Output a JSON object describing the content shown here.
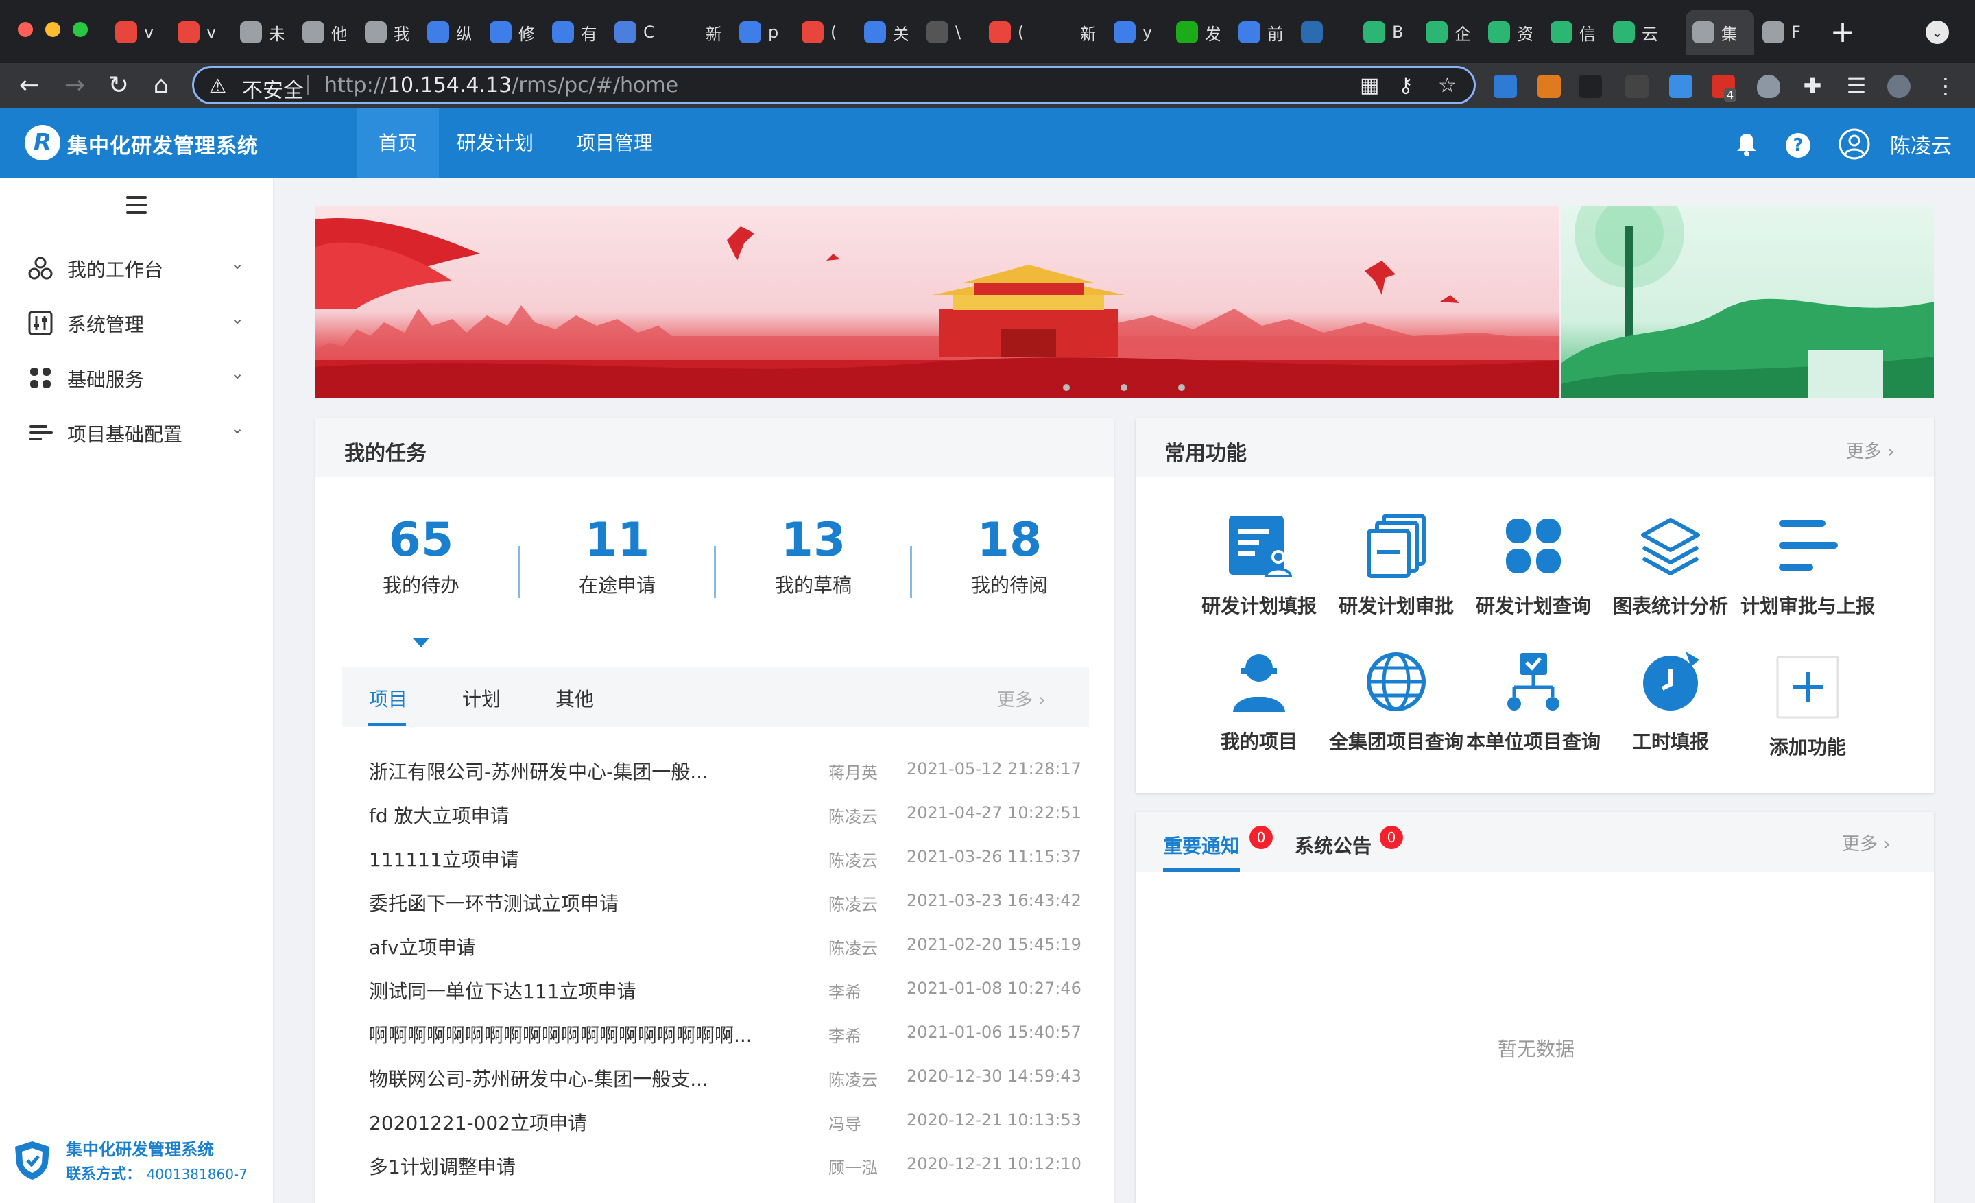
{
  "browser": {
    "tabs": [
      {
        "title": "v",
        "color": "#e8453c"
      },
      {
        "title": "v",
        "color": "#e8453c"
      },
      {
        "title": "未",
        "color": "#9aa0a6"
      },
      {
        "title": "他",
        "color": "#9aa0a6"
      },
      {
        "title": "我",
        "color": "#9aa0a6"
      },
      {
        "title": "纵",
        "color": "#3f7de8"
      },
      {
        "title": "修",
        "color": "#3f7de8"
      },
      {
        "title": "有",
        "color": "#3f7de8"
      },
      {
        "title": "C",
        "color": "#4a7fe0"
      },
      {
        "title": "新标签",
        "color": "#202124"
      },
      {
        "title": "p",
        "color": "#3f7de8"
      },
      {
        "title": "(",
        "color": "#e8453c"
      },
      {
        "title": "关",
        "color": "#3f7de8"
      },
      {
        "title": "\\",
        "color": "#555"
      },
      {
        "title": "(",
        "color": "#e8453c"
      },
      {
        "title": "新标签",
        "color": "#202124"
      },
      {
        "title": "y",
        "color": "#3f7de8"
      },
      {
        "title": "发",
        "color": "#1aad19"
      },
      {
        "title": "前",
        "color": "#3f7de8"
      },
      {
        "title": "",
        "color": "#2b6cb0"
      },
      {
        "title": "B",
        "color": "#2bb673"
      },
      {
        "title": "企",
        "color": "#2bb673"
      },
      {
        "title": "资",
        "color": "#2bb673"
      },
      {
        "title": "信",
        "color": "#2bb673"
      },
      {
        "title": "云",
        "color": "#2bb673"
      },
      {
        "title": "集",
        "color": "#9aa0a6"
      },
      {
        "title": "F",
        "color": "#9aa0a6"
      }
    ],
    "insecure_label": "不安全",
    "url_scheme": "http://",
    "url_host": "10.154.4.13",
    "url_path": "/rms/pc/#/home",
    "extension_badge": "4"
  },
  "header": {
    "app_title": "集中化研发管理系统",
    "logo_letter": "R",
    "nav": [
      "首页",
      "研发计划",
      "项目管理"
    ],
    "user_name": "陈凌云",
    "help_glyph": "?"
  },
  "sidebar": {
    "items": [
      {
        "label": "我的工作台"
      },
      {
        "label": "系统管理"
      },
      {
        "label": "基础服务"
      },
      {
        "label": "项目基础配置"
      }
    ],
    "footer_title": "集中化研发管理系统",
    "footer_contact_label": "联系方式：",
    "footer_contact": "4001381860-7"
  },
  "tasks": {
    "title": "我的任务",
    "stats": [
      {
        "value": "65",
        "label": "我的待办"
      },
      {
        "value": "11",
        "label": "在途申请"
      },
      {
        "value": "13",
        "label": "我的草稿"
      },
      {
        "value": "18",
        "label": "我的待阅"
      }
    ],
    "tabs": [
      "项目",
      "计划",
      "其他"
    ],
    "more": "更多",
    "rows": [
      {
        "name": "浙江有限公司-苏州研发中心-集团一般...",
        "who": "蒋月英",
        "when": "2021-05-12 21:28:17"
      },
      {
        "name": "fd 放大立项申请",
        "who": "陈凌云",
        "when": "2021-04-27 10:22:51"
      },
      {
        "name": "111111立项申请",
        "who": "陈凌云",
        "when": "2021-03-26 11:15:37"
      },
      {
        "name": "委托函下一环节测试立项申请",
        "who": "陈凌云",
        "when": "2021-03-23 16:43:42"
      },
      {
        "name": "afv立项申请",
        "who": "陈凌云",
        "when": "2021-02-20 15:45:19"
      },
      {
        "name": "测试同一单位下达111立项申请",
        "who": "李希",
        "when": "2021-01-08 10:27:46"
      },
      {
        "name": "啊啊啊啊啊啊啊啊啊啊啊啊啊啊啊啊啊啊啊...",
        "who": "李希",
        "when": "2021-01-06 15:40:57"
      },
      {
        "name": "物联网公司-苏州研发中心-集团一般支...",
        "who": "陈凌云",
        "when": "2020-12-30 14:59:43"
      },
      {
        "name": "20201221-002立项申请",
        "who": "冯导",
        "when": "2020-12-21 10:13:53"
      },
      {
        "name": "多1计划调整申请",
        "who": "顾一泓",
        "when": "2020-12-21 10:12:10"
      }
    ]
  },
  "functions": {
    "title": "常用功能",
    "more": "更多",
    "items": [
      {
        "label": "研发计划填报",
        "icon": "form-edit-icon"
      },
      {
        "label": "研发计划审批",
        "icon": "copy-doc-icon"
      },
      {
        "label": "研发计划查询",
        "icon": "grid-apps-icon"
      },
      {
        "label": "图表统计分析",
        "icon": "layers-icon"
      },
      {
        "label": "计划审批与上报",
        "icon": "align-left-icon"
      },
      {
        "label": "我的项目",
        "icon": "user-icon"
      },
      {
        "label": "全集团项目查询",
        "icon": "globe-icon"
      },
      {
        "label": "本单位项目查询",
        "icon": "org-tree-icon"
      },
      {
        "label": "工时填报",
        "icon": "clock-icon"
      },
      {
        "label": "添加功能",
        "icon": "plus-icon"
      }
    ]
  },
  "notices": {
    "tabs": [
      {
        "label": "重要通知",
        "count": "0"
      },
      {
        "label": "系统公告",
        "count": "0"
      }
    ],
    "more": "更多",
    "empty_text": "暂无数据"
  },
  "colors": {
    "primary": "#1b7fcf",
    "badge": "#f5222d"
  }
}
